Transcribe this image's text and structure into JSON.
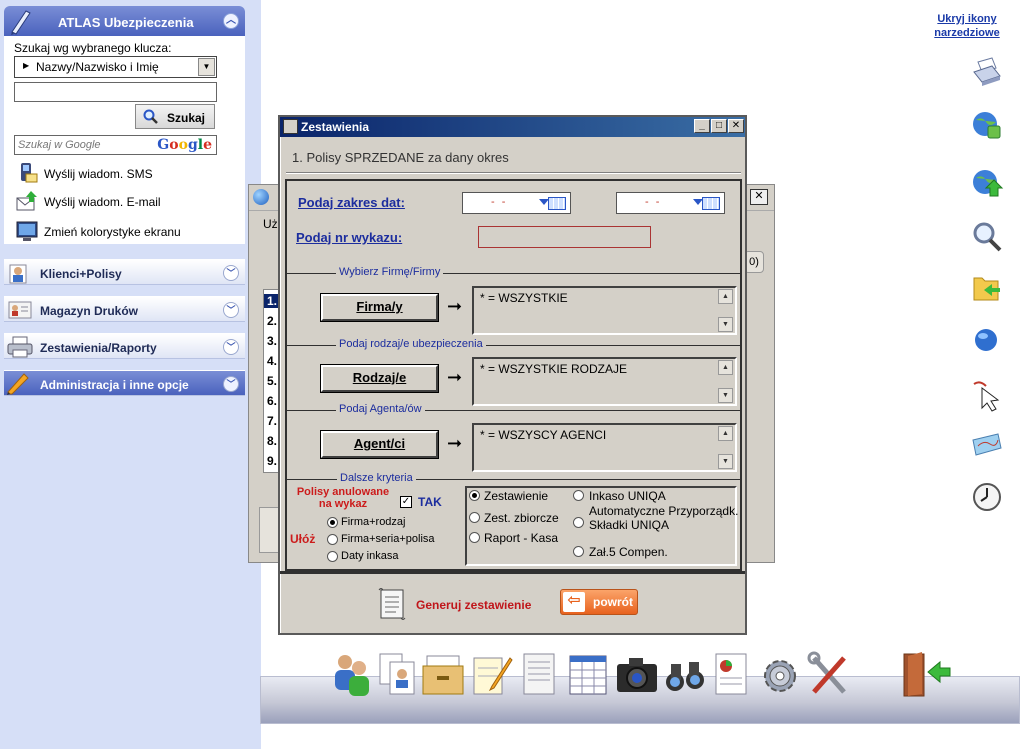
{
  "sidebar": {
    "app_title": "ATLAS Ubezpieczenia",
    "search_label": "Szukaj wg wybranego klucza:",
    "search_key": "Nazwy/Nazwisko i Imię",
    "search_value": "",
    "search_button": "Szukaj",
    "google_placeholder": "Szukaj w Google",
    "google_logo": "Google",
    "links": [
      {
        "label": "Wyślij wiadom. SMS",
        "icon": "sms-phone-icon"
      },
      {
        "label": "Wyślij wiadom. E-mail",
        "icon": "email-icon"
      },
      {
        "label": "Zmień kolorystyke ekranu",
        "icon": "monitor-icon"
      }
    ],
    "sections": [
      {
        "label": "Klienci+Polisy",
        "icon": "clients-icon"
      },
      {
        "label": "Magazyn Druków",
        "icon": "print-storage-icon"
      },
      {
        "label": "Zestawienia/Raporty",
        "icon": "printer-icon"
      },
      {
        "label": "Administracja i inne opcje",
        "icon": "pencil-icon"
      }
    ]
  },
  "toolbar_right": {
    "hide_link": "Ukryj ikony narzedziowe",
    "icons": [
      "printer-icon",
      "globe-lock-icon",
      "globe-upload-icon",
      "magnifier-icon",
      "folder-arrow-icon",
      "globe-icon",
      "mouse-cursor-icon",
      "map-icon",
      "clock-icon"
    ]
  },
  "background_dialog": {
    "label_partial": "Uż",
    "row_numbers": [
      "1.",
      "2.",
      "3.",
      "4.",
      "5.",
      "6.",
      "7.",
      "8.",
      "9."
    ],
    "close_symbol": "✕",
    "button_partial": "0)"
  },
  "dialog": {
    "title": "Zestawienia",
    "heading": "1. Polisy SPRZEDANE za dany okres",
    "date_range_label": "Podaj zakres dat:",
    "date_from": "- -",
    "date_to": "- -",
    "wykaz_label": "Podaj nr wykazu:",
    "wykaz_value": "",
    "firm_group_caption": "Wybierz Firmę/Firmy",
    "firm_button": "Firma/y",
    "firm_value": "*  = WSZYSTKIE",
    "type_group_caption": "Podaj rodzaj/e ubezpieczenia",
    "type_button": "Rodzaj/e",
    "type_value": "* = WSZYSTKIE RODZAJE",
    "agent_group_caption": "Podaj  Agenta/ów",
    "agent_button": "Agent/ci",
    "agent_value": "* = WSZYSCY AGENCI",
    "criteria_caption": "Dalsze kryteria",
    "cancelled_label": "Polisy anulowane na wykaz",
    "cancelled_checked": true,
    "tak_label": "TAK",
    "sort_label": "Ułóż",
    "sort_options": [
      {
        "label": "Firma+rodzaj",
        "selected": true
      },
      {
        "label": "Firma+seria+polisa",
        "selected": false
      },
      {
        "label": "Daty inkasa",
        "selected": false
      }
    ],
    "report_options": [
      {
        "label": "Zestawienie",
        "selected": true
      },
      {
        "label": "Zest. zbiorcze",
        "selected": false
      },
      {
        "label": "Raport - Kasa",
        "selected": false
      },
      {
        "label": "Inkaso UNIQA",
        "selected": false
      },
      {
        "label": "Automatyczne Przyporządk. Składki UNIQA",
        "selected": false
      },
      {
        "label": "Zał.5 Compen.",
        "selected": false
      }
    ],
    "generate_label": "Generuj zestawienie",
    "back_label": "powrót"
  },
  "dock": {
    "icons": [
      "users-icon",
      "documents-person-icon",
      "filing-cabinet-icon",
      "notepad-pencil-icon",
      "document-lines-icon",
      "table-sheet-icon",
      "camera-icon",
      "binoculars-icon",
      "report-chart-icon",
      "gear-icon",
      "tools-icon",
      "exit-door-icon"
    ]
  },
  "colors": {
    "sidebar_bg": "#d6dff7",
    "header_blue": "#4a62bd",
    "dialog_title": "#0a246a",
    "label_blue": "#1c2d9e",
    "accent_red": "#cc1b1b",
    "back_orange": "#e8621e"
  }
}
